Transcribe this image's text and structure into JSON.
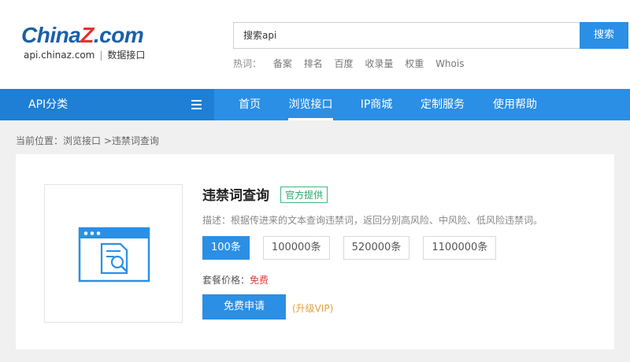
{
  "logo": {
    "brand_main": "China",
    "brand_z": "Z",
    "brand_dotcom": ".com",
    "domain": "api.chinaz.com",
    "separator": "|",
    "tagline": "数据接口"
  },
  "search": {
    "value": "搜索api",
    "button_label": "搜索"
  },
  "hot_words": {
    "label": "热词：",
    "items": [
      "备案",
      "排名",
      "百度",
      "收录量",
      "权重",
      "Whois"
    ]
  },
  "nav": {
    "category_label": "API分类",
    "items": [
      {
        "label": "首页",
        "active": false
      },
      {
        "label": "浏览接口",
        "active": true
      },
      {
        "label": "IP商城",
        "active": false
      },
      {
        "label": "定制服务",
        "active": false
      },
      {
        "label": "使用帮助",
        "active": false
      }
    ]
  },
  "breadcrumb": "当前位置：浏览接口 >违禁词查询",
  "product": {
    "title": "违禁词查询",
    "badge": "官方提供",
    "description": "描述：根据传进来的文本查询违禁词，返回分别高风险、中风险、低风险违禁词。",
    "packages": [
      "100条",
      "100000条",
      "520000条",
      "1100000条"
    ],
    "selected_package": "100条",
    "price_label": "套餐价格：",
    "price_value": "免费",
    "apply_button": "免费申请",
    "vip_link": "(升级VIP)",
    "icon": "document-search-icon"
  },
  "colors": {
    "primary": "#2b8fe6",
    "nav_category_bg": "#1f7fd4",
    "free_red": "#e23b3b",
    "badge_green": "#2aa766",
    "vip_orange": "#e0a040"
  }
}
